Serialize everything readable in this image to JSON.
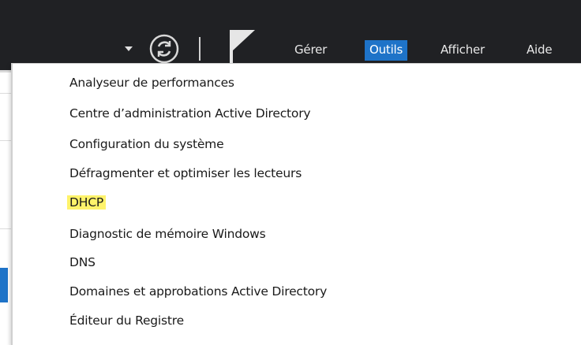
{
  "toolbar": {
    "menus": [
      {
        "label": "Gérer"
      },
      {
        "label": "Outils"
      },
      {
        "label": "Afficher"
      },
      {
        "label": "Aide"
      }
    ]
  },
  "tools_menu": {
    "items": [
      {
        "label": "Analyseur de performances"
      },
      {
        "label": "Centre d’administration Active Directory"
      },
      {
        "label": "Configuration du système"
      },
      {
        "label": "Défragmenter et optimiser les lecteurs"
      },
      {
        "label": "DHCP",
        "highlighted": true
      },
      {
        "label": "Diagnostic de mémoire Windows"
      },
      {
        "label": "DNS"
      },
      {
        "label": "Domaines et approbations Active Directory"
      },
      {
        "label": "Éditeur du Registre"
      }
    ]
  },
  "colors": {
    "topbar_bg": "#202124",
    "active_menu": "#1e73c8",
    "highlight": "#fff36b"
  }
}
